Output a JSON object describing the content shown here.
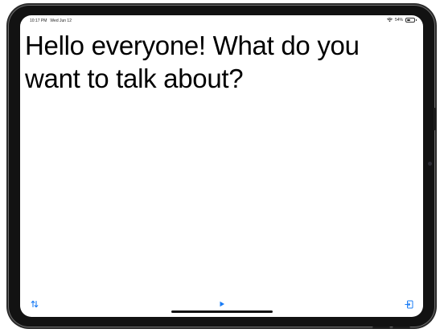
{
  "status_bar": {
    "time": "10:17 PM",
    "date": "Wed Jun 12",
    "battery_text": "54%",
    "battery_level": 0.54
  },
  "main": {
    "message": "Hello everyone! What do you want to talk about?"
  },
  "toolbar": {
    "icons": {
      "swap": "swap-vertical-icon",
      "play": "play-icon",
      "exit": "exit-icon"
    },
    "accent_color": "#1a7cf5"
  }
}
